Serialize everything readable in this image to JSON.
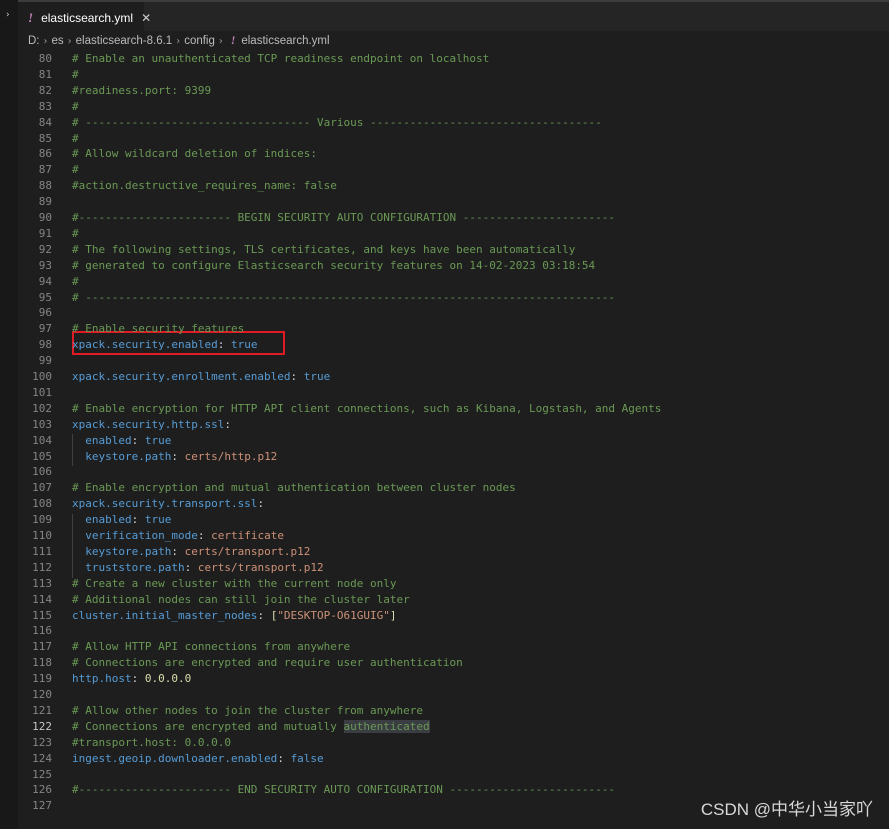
{
  "tab": {
    "icon": "!",
    "title": "elasticsearch.yml",
    "close": "✕"
  },
  "breadcrumb": {
    "items": [
      "D:",
      "es",
      "elasticsearch-8.6.1",
      "config"
    ],
    "file_icon": "!",
    "file": "elasticsearch.yml"
  },
  "active_line": 122,
  "lines": [
    {
      "n": "80",
      "t": [
        [
          "c",
          "# Enable an unauthenticated TCP readiness endpoint on localhost"
        ]
      ]
    },
    {
      "n": "81",
      "t": [
        [
          "c",
          "#"
        ]
      ]
    },
    {
      "n": "82",
      "t": [
        [
          "c",
          "#readiness.port: 9399"
        ]
      ]
    },
    {
      "n": "83",
      "t": [
        [
          "c",
          "#"
        ]
      ]
    },
    {
      "n": "84",
      "t": [
        [
          "c",
          "# ---------------------------------- Various -----------------------------------"
        ]
      ]
    },
    {
      "n": "85",
      "t": [
        [
          "c",
          "#"
        ]
      ]
    },
    {
      "n": "86",
      "t": [
        [
          "c",
          "# Allow wildcard deletion of indices:"
        ]
      ]
    },
    {
      "n": "87",
      "t": [
        [
          "c",
          "#"
        ]
      ]
    },
    {
      "n": "88",
      "t": [
        [
          "c",
          "#action.destructive_requires_name: false"
        ]
      ]
    },
    {
      "n": "89",
      "t": []
    },
    {
      "n": "90",
      "t": [
        [
          "c",
          "#----------------------- BEGIN SECURITY AUTO CONFIGURATION -----------------------"
        ]
      ]
    },
    {
      "n": "91",
      "t": [
        [
          "c",
          "#"
        ]
      ]
    },
    {
      "n": "92",
      "t": [
        [
          "c",
          "# The following settings, TLS certificates, and keys have been automatically"
        ]
      ]
    },
    {
      "n": "93",
      "t": [
        [
          "c",
          "# generated to configure Elasticsearch security features on 14-02-2023 03:18:54"
        ]
      ]
    },
    {
      "n": "94",
      "t": [
        [
          "c",
          "#"
        ]
      ]
    },
    {
      "n": "95",
      "t": [
        [
          "c",
          "# --------------------------------------------------------------------------------"
        ]
      ]
    },
    {
      "n": "96",
      "t": []
    },
    {
      "n": "97",
      "t": [
        [
          "c",
          "# Enable security features"
        ]
      ]
    },
    {
      "n": "98",
      "t": [
        [
          "k",
          "xpack.security.enabled"
        ],
        [
          "p",
          ": "
        ],
        [
          "k",
          "true"
        ]
      ]
    },
    {
      "n": "99",
      "t": []
    },
    {
      "n": "100",
      "t": [
        [
          "k",
          "xpack.security.enrollment.enabled"
        ],
        [
          "p",
          ": "
        ],
        [
          "k",
          "true"
        ]
      ]
    },
    {
      "n": "101",
      "t": []
    },
    {
      "n": "102",
      "t": [
        [
          "c",
          "# Enable encryption for HTTP API client connections, such as Kibana, Logstash, and Agents"
        ]
      ]
    },
    {
      "n": "103",
      "t": [
        [
          "k",
          "xpack.security.http.ssl"
        ],
        [
          "p",
          ":"
        ]
      ]
    },
    {
      "n": "104",
      "t": [
        [
          "p",
          "  "
        ],
        [
          "k",
          "enabled"
        ],
        [
          "p",
          ": "
        ],
        [
          "k",
          "true"
        ]
      ]
    },
    {
      "n": "105",
      "t": [
        [
          "p",
          "  "
        ],
        [
          "k",
          "keystore.path"
        ],
        [
          "p",
          ": "
        ],
        [
          "s",
          "certs/http.p12"
        ]
      ]
    },
    {
      "n": "106",
      "t": []
    },
    {
      "n": "107",
      "t": [
        [
          "c",
          "# Enable encryption and mutual authentication between cluster nodes"
        ]
      ]
    },
    {
      "n": "108",
      "t": [
        [
          "k",
          "xpack.security.transport.ssl"
        ],
        [
          "p",
          ":"
        ]
      ]
    },
    {
      "n": "109",
      "t": [
        [
          "p",
          "  "
        ],
        [
          "k",
          "enabled"
        ],
        [
          "p",
          ": "
        ],
        [
          "k",
          "true"
        ]
      ]
    },
    {
      "n": "110",
      "t": [
        [
          "p",
          "  "
        ],
        [
          "k",
          "verification_mode"
        ],
        [
          "p",
          ": "
        ],
        [
          "s",
          "certificate"
        ]
      ]
    },
    {
      "n": "111",
      "t": [
        [
          "p",
          "  "
        ],
        [
          "k",
          "keystore.path"
        ],
        [
          "p",
          ": "
        ],
        [
          "s",
          "certs/transport.p12"
        ]
      ]
    },
    {
      "n": "112",
      "t": [
        [
          "p",
          "  "
        ],
        [
          "k",
          "truststore.path"
        ],
        [
          "p",
          ": "
        ],
        [
          "s",
          "certs/transport.p12"
        ]
      ]
    },
    {
      "n": "113",
      "t": [
        [
          "c",
          "# Create a new cluster with the current node only"
        ]
      ]
    },
    {
      "n": "114",
      "t": [
        [
          "c",
          "# Additional nodes can still join the cluster later"
        ]
      ]
    },
    {
      "n": "115",
      "t": [
        [
          "k",
          "cluster.initial_master_nodes"
        ],
        [
          "p",
          ": "
        ],
        [
          "v",
          "["
        ],
        [
          "s",
          "\"DESKTOP-O61GUIG\""
        ],
        [
          "v",
          "]"
        ]
      ]
    },
    {
      "n": "116",
      "t": []
    },
    {
      "n": "117",
      "t": [
        [
          "c",
          "# Allow HTTP API connections from anywhere"
        ]
      ]
    },
    {
      "n": "118",
      "t": [
        [
          "c",
          "# Connections are encrypted and require user authentication"
        ]
      ]
    },
    {
      "n": "119",
      "t": [
        [
          "k",
          "http.host"
        ],
        [
          "p",
          ": "
        ],
        [
          "v",
          "0.0.0.0"
        ]
      ]
    },
    {
      "n": "120",
      "t": []
    },
    {
      "n": "121",
      "t": [
        [
          "c",
          "# Allow other nodes to join the cluster from anywhere"
        ]
      ]
    },
    {
      "n": "122",
      "t": [
        [
          "c",
          "# Connections are encrypted and mutually "
        ],
        [
          "ch",
          "authenticated"
        ]
      ]
    },
    {
      "n": "123",
      "t": [
        [
          "c",
          "#transport.host: 0.0.0.0"
        ]
      ]
    },
    {
      "n": "124",
      "t": [
        [
          "k",
          "ingest.geoip.downloader.enabled"
        ],
        [
          "p",
          ": "
        ],
        [
          "k",
          "false"
        ]
      ]
    },
    {
      "n": "125",
      "t": []
    },
    {
      "n": "126",
      "t": [
        [
          "c",
          "#----------------------- END SECURITY AUTO CONFIGURATION -------------------------"
        ]
      ]
    },
    {
      "n": "127",
      "t": []
    }
  ],
  "watermark": "CSDN @中华小当家吖",
  "colors": {
    "comment": "#6a9955",
    "key": "#569cd6",
    "string": "#ce9178",
    "value": "#dcdcaa",
    "annotation_box": "#e01b24",
    "yaml_icon": "#c586c0"
  }
}
